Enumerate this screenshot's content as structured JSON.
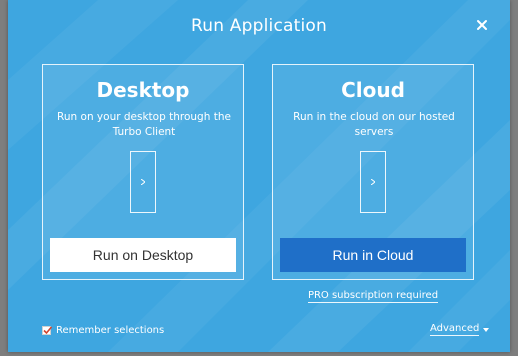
{
  "dialog": {
    "title": "Run Application",
    "close_icon": "close-icon"
  },
  "desktop": {
    "title": "Desktop",
    "description": "Run on your desktop through the Turbo Client",
    "button_label": "Run on Desktop"
  },
  "cloud": {
    "title": "Cloud",
    "description": "Run in the cloud on our hosted servers",
    "button_label": "Run in Cloud",
    "pro_link": "PRO subscription required"
  },
  "footer": {
    "remember_label": "Remember selections",
    "remember_checked": true,
    "advanced_label": "Advanced"
  },
  "colors": {
    "dialog_bg": "#3ea6e0",
    "primary_button": "#1f6fc8",
    "light_button": "#ffffff",
    "text": "#ffffff"
  }
}
